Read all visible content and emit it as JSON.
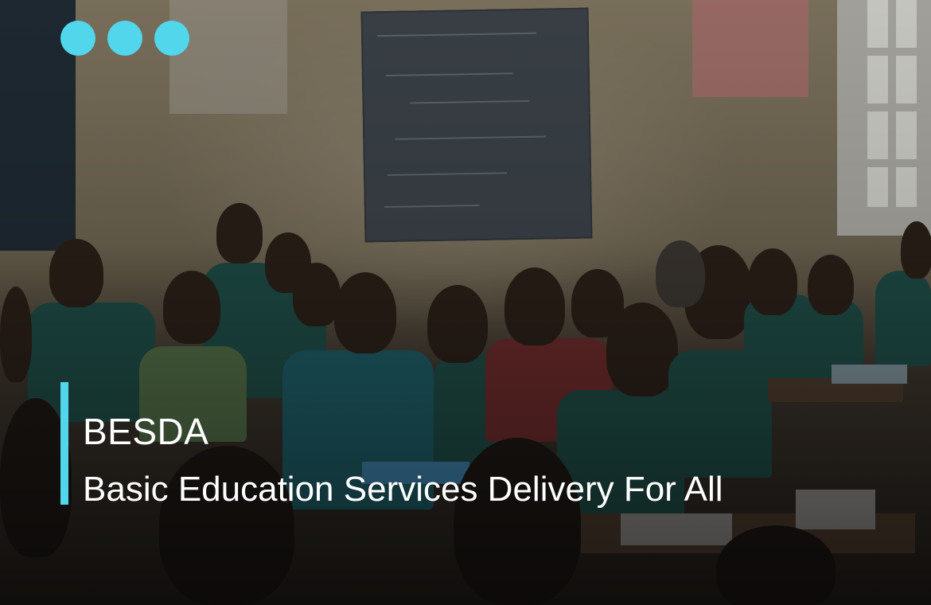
{
  "slide": {
    "title": "BESDA",
    "subtitle": "Basic Education Services Delivery For All",
    "accent_color": "#52d6ec",
    "dots": [
      "dot",
      "dot",
      "dot"
    ]
  },
  "background": {
    "description_icon": "classroom-photo"
  }
}
